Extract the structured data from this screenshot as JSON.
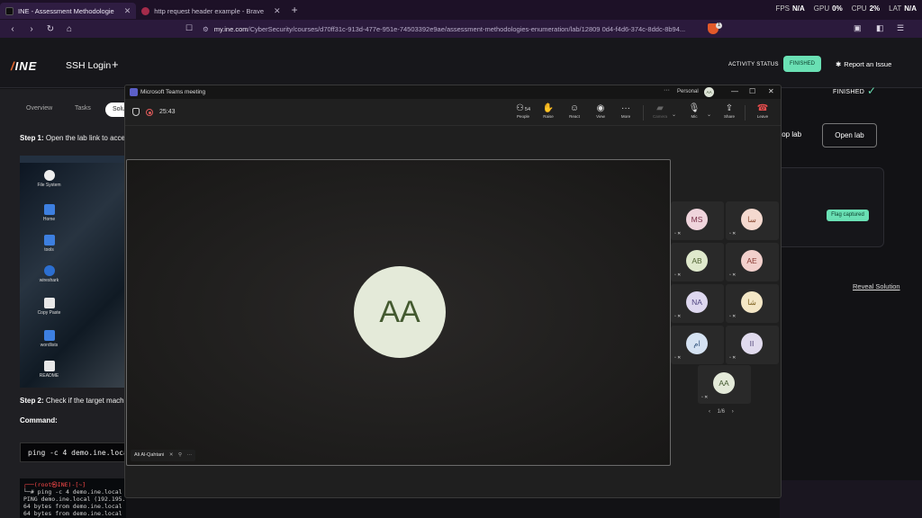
{
  "browser": {
    "tabs": [
      {
        "title": "INE - Assessment Methodologie"
      },
      {
        "title": "http request header example - Brave"
      }
    ],
    "perf": [
      {
        "label": "FPS",
        "value": "N/A"
      },
      {
        "label": "GPU",
        "value": "0%"
      },
      {
        "label": "CPU",
        "value": "2%"
      },
      {
        "label": "LAT",
        "value": "N/A"
      }
    ],
    "url_host": "my.ine.com",
    "url_path": "/CyberSecurity/courses/d70ff31c-913d-477e-951e-74503392e9ae/assessment-methodologies-enumeration/lab/12809 0d4-f4d6-374c-8ddc-8b94...",
    "brave_count": "1"
  },
  "ine": {
    "logo": "INE",
    "lab_title": "SSH Login",
    "activity_status_label": "ACTIVITY STATUS",
    "status_badge": "FINISHED",
    "report_issue": "Report an Issue",
    "tabs": [
      "Overview",
      "Tasks",
      "Solu"
    ],
    "step1_title": "Step 1:",
    "step1_text": "Open the lab link to acce",
    "desktop_icons": [
      "File System",
      "Home",
      "tools",
      "wireshark",
      "Copy Paste",
      "wordlists",
      "README"
    ],
    "step2_title": "Step 2:",
    "step2_text": "Check if the target mach",
    "command_label": "Command:",
    "command": "ping -c 4 demo.ine.local",
    "terminal": {
      "prompt": "┌──(root㉿INE)-[~]",
      "cmd": "└─# ping -c 4 demo.ine.local",
      "lines": [
        "PING demo.ine.local (192.195.154.3) 56(84) bytes of data.",
        "64 bytes from demo.ine.local (192.195.154.3): icmp_seq=1 ttl=64 time=0.100 ms",
        "64 bytes from demo.ine.local (192.195.154.3): icmp_seq=2 ttl=64 time=0.052 ms"
      ]
    },
    "finished_label": "FINISHED",
    "stop_lab": "top lab",
    "open_lab": "Open lab",
    "flag_captured": "Flag captured",
    "reveal_solution": "Reveal Solution"
  },
  "teams": {
    "window_title": "Microsoft Teams meeting",
    "personal": "Personal",
    "account_initials": "AA",
    "timer": "25:43",
    "toolbar": [
      {
        "label": "People",
        "icon": "people-icon",
        "count": "54"
      },
      {
        "label": "Raise",
        "icon": "hand-icon"
      },
      {
        "label": "React",
        "icon": "smile-icon"
      },
      {
        "label": "View",
        "icon": "view-icon"
      },
      {
        "label": "More",
        "icon": "more-icon"
      },
      {
        "label": "Camera",
        "icon": "camera-icon"
      },
      {
        "label": "Mic",
        "icon": "mic-icon"
      },
      {
        "label": "Share",
        "icon": "share-icon"
      },
      {
        "label": "Leave",
        "icon": "phone-icon"
      }
    ],
    "main_initials": "AA",
    "presenter_name": "Ali Al-Qahtani",
    "participants": [
      {
        "initials": "MS",
        "bg": "#efd4dc",
        "fg": "#7a3048"
      },
      {
        "initials": "سا",
        "bg": "#f4d9cf",
        "fg": "#8a4a33"
      },
      {
        "initials": "AB",
        "bg": "#dfe9cc",
        "fg": "#4e6130"
      },
      {
        "initials": "AE",
        "bg": "#f2d0cc",
        "fg": "#8a3a33"
      },
      {
        "initials": "NA",
        "bg": "#ded8ef",
        "fg": "#4f4580"
      },
      {
        "initials": "شا",
        "bg": "#f4e7c6",
        "fg": "#7f6320"
      },
      {
        "initials": "ام",
        "bg": "#d5e2f2",
        "fg": "#36577f"
      },
      {
        "initials": "II",
        "bg": "#e1dbee",
        "fg": "#574b7e"
      },
      {
        "initials": "AA",
        "bg": "#e4ead9",
        "fg": "#43592f"
      }
    ],
    "pager": "1/6"
  }
}
